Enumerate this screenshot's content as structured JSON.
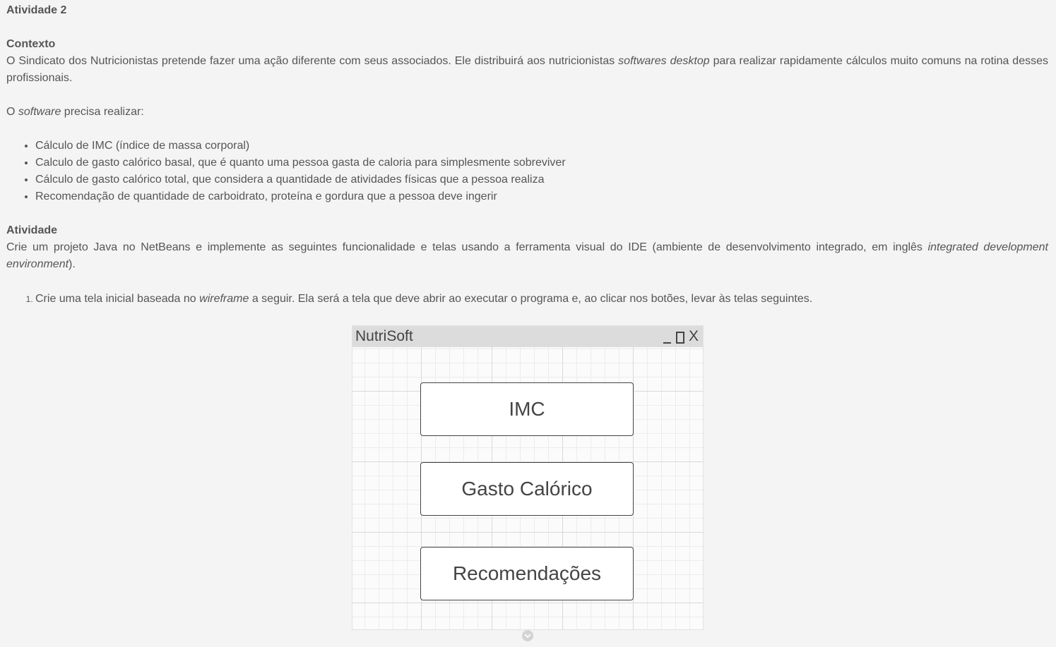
{
  "activity_title": "Atividade 2",
  "context": {
    "heading": "Contexto",
    "p1_a": "O Sindicato dos Nutricionistas pretende fazer uma ação diferente com seus associados. Ele distribuirá aos nutricionistas ",
    "p1_em": "softwares desktop",
    "p1_b": " para realizar rapidamente cálculos muito comuns na rotina desses profissionais.",
    "p2_a": "O ",
    "p2_em": "software",
    "p2_b": " precisa realizar:",
    "items": [
      "Cálculo de IMC (índice de massa corporal)",
      "Calculo de gasto calórico basal, que é quanto uma pessoa gasta de caloria para simplesmente sobreviver",
      "Cálculo de gasto calórico total, que considera a quantidade de atividades físicas que a pessoa realiza",
      "Recomendação de quantidade de carboidrato, proteína e gordura que a pessoa deve ingerir"
    ]
  },
  "activity": {
    "heading": "Atividade",
    "p_a": "Crie um projeto Java no NetBeans e implemente as seguintes funcionalidade e telas usando a ferramenta visual do IDE (ambiente de desenvolvimento integrado, em inglês ",
    "p_em": "integrated development environment",
    "p_b": ").",
    "step1_a": "Crie uma tela inicial baseada no ",
    "step1_em": "wireframe",
    "step1_b": " a seguir. Ela será a tela que deve abrir ao executar o programa e, ao clicar nos botões, levar às telas seguintes."
  },
  "wireframe": {
    "window_title": "NutriSoft",
    "minimize_icon": "minimize-icon",
    "maximize_icon": "maximize-icon",
    "close_label": "X",
    "buttons": [
      "IMC",
      "Gasto Calórico",
      "Recomendações"
    ]
  },
  "colors": {
    "page_bg": "#f4f4f4",
    "text": "#555555",
    "titlebar": "#dcdcdc"
  }
}
